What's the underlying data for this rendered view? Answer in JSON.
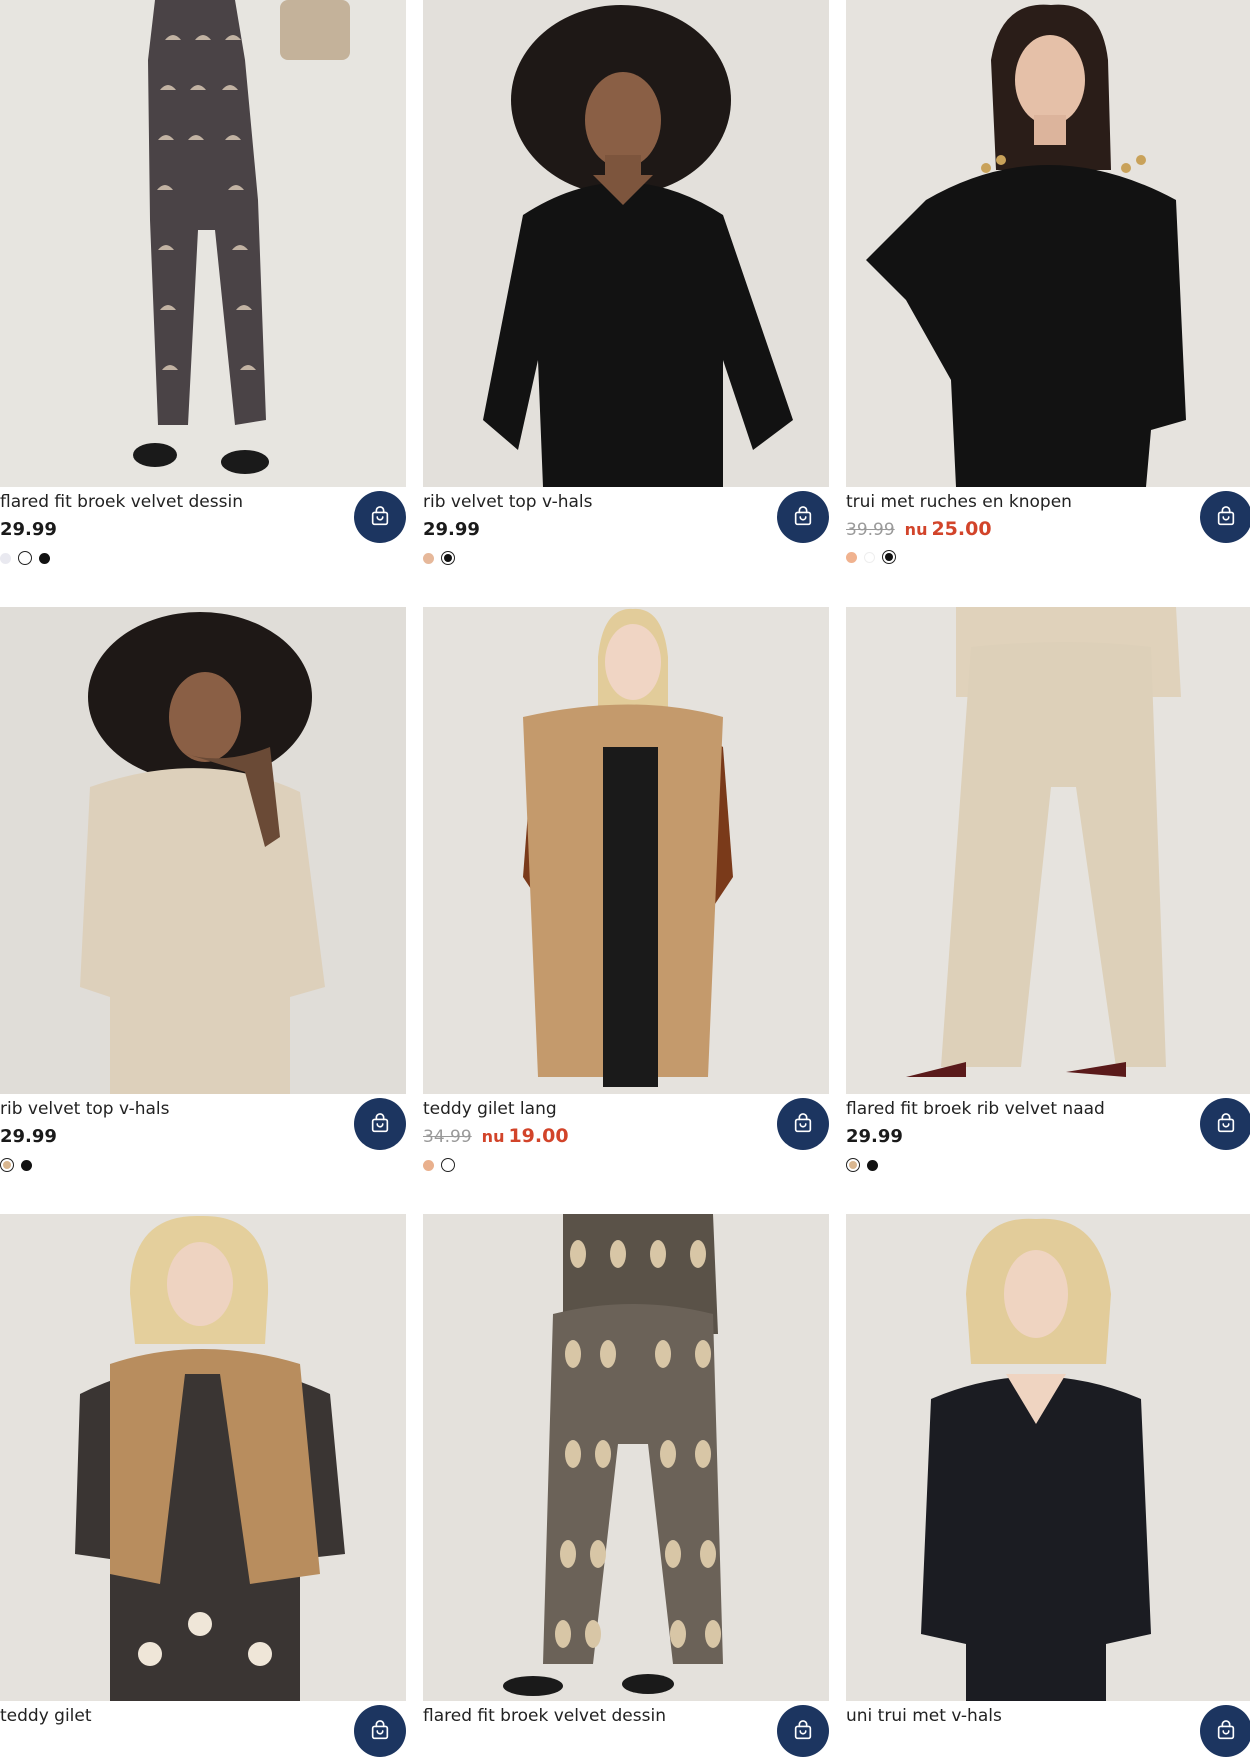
{
  "colors": {
    "cart_bg": "#1c3560",
    "sale": "#d2442a",
    "old_price": "#9a9a9a"
  },
  "products": [
    {
      "name": "flared fit broek velvet dessin",
      "price": "29.99",
      "swatches": [
        "#e9e9f0",
        "#ffffff",
        "#111111"
      ],
      "selected": 1,
      "icon": "shopping-bag-icon"
    },
    {
      "name": "rib velvet top v-hals",
      "price": "29.99",
      "swatches": [
        "#e6b89a",
        "#111111"
      ],
      "selected": 1,
      "icon": "shopping-bag-icon"
    },
    {
      "name": "trui met ruches en knopen",
      "old_price": "39.99",
      "nu": "nu",
      "sale_price": "25.00",
      "swatches": [
        "#f0b28f",
        "#ffffff",
        "#111111"
      ],
      "selected": 2,
      "icon": "shopping-bag-icon"
    },
    {
      "name": "rib velvet top v-hals",
      "price": "29.99",
      "swatches": [
        "#d9b68f",
        "#111111"
      ],
      "selected": 0,
      "icon": "shopping-bag-icon"
    },
    {
      "name": "teddy gilet lang",
      "old_price": "34.99",
      "nu": "nu",
      "sale_price": "19.00",
      "swatches": [
        "#e9b08d",
        "#ffffff"
      ],
      "selected": 1,
      "icon": "shopping-bag-icon"
    },
    {
      "name": "flared fit broek rib velvet naad",
      "price": "29.99",
      "swatches": [
        "#d9b68f",
        "#111111"
      ],
      "selected": 0,
      "icon": "shopping-bag-icon"
    },
    {
      "name": "teddy gilet",
      "icon": "shopping-bag-icon"
    },
    {
      "name": "flared fit broek velvet dessin",
      "icon": "shopping-bag-icon"
    },
    {
      "name": "uni trui met v-hals",
      "icon": "shopping-bag-icon"
    }
  ]
}
